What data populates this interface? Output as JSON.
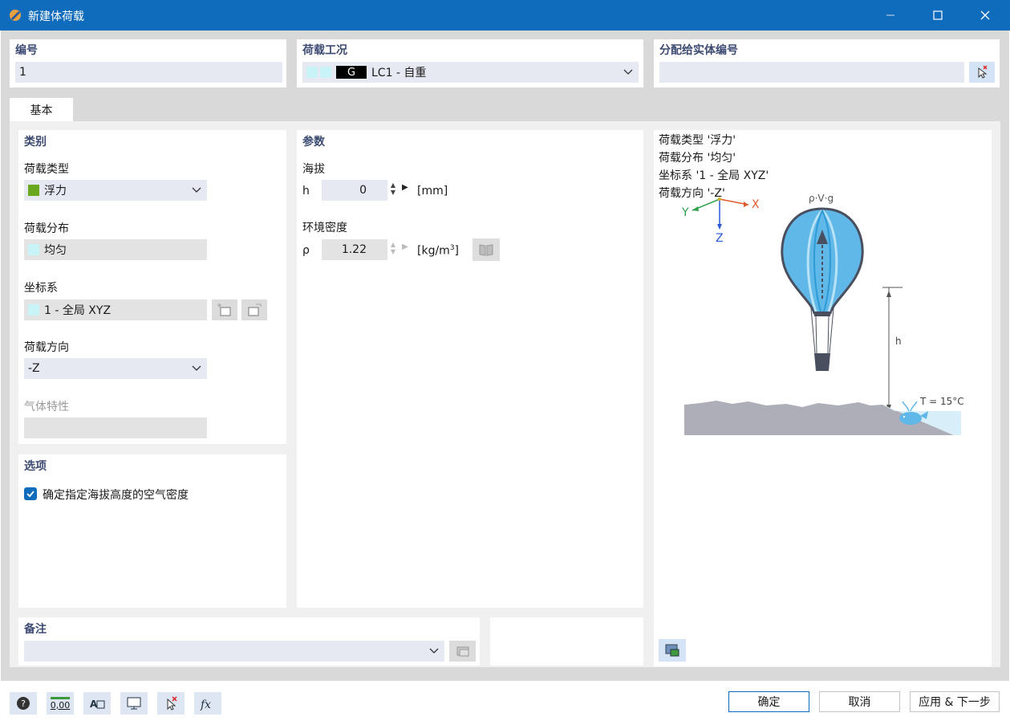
{
  "window": {
    "title": "新建体荷载"
  },
  "header": {
    "number_label": "编号",
    "number_value": "1",
    "load_case_label": "荷载工况",
    "load_case_code": "G",
    "load_case_value": "LC1 - 自重",
    "assign_label": "分配给实体编号",
    "assign_value": ""
  },
  "tabs": [
    {
      "label": "基本"
    }
  ],
  "category": {
    "section_title": "类别",
    "load_type_label": "荷载类型",
    "load_type_value": "浮力",
    "load_type_color": "#6aa820",
    "distribution_label": "荷载分布",
    "distribution_value": "均匀",
    "coord_label": "坐标系",
    "coord_value": "1 - 全局 XYZ",
    "direction_label": "荷载方向",
    "direction_value": "-Z",
    "gas_label": "气体特性",
    "gas_value": ""
  },
  "options": {
    "section_title": "选项",
    "checkbox_label": "确定指定海拔高度的空气密度",
    "checked": true
  },
  "params": {
    "section_title": "参数",
    "altitude_label": "海拔",
    "h_symbol": "h",
    "h_value": "0",
    "h_unit": "[mm]",
    "density_label": "环境密度",
    "rho_symbol": "ρ",
    "rho_value": "1.22",
    "rho_unit_prefix": "[kg/m",
    "rho_unit_exp": "3",
    "rho_unit_suffix": "]"
  },
  "info": {
    "lines": [
      "荷载类型 '浮力'",
      "荷载分布 '均匀'",
      "坐标系 '1 - 全局 XYZ'",
      "荷载方向 '-Z'"
    ],
    "formula": "ρ·V·g",
    "axis_x": "X",
    "axis_y": "Y",
    "axis_z": "Z",
    "h_label": "h",
    "temperature": "T = 15°C"
  },
  "comment": {
    "label": "备注",
    "value": ""
  },
  "buttons": {
    "ok": "确定",
    "cancel": "取消",
    "apply_next": "应用 & 下一步"
  },
  "toolbar": {
    "units_label": "0,00"
  },
  "colors": {
    "accent": "#0f6cbd",
    "balloon": "#5fb8e8",
    "section_title": "#3d4b73"
  }
}
